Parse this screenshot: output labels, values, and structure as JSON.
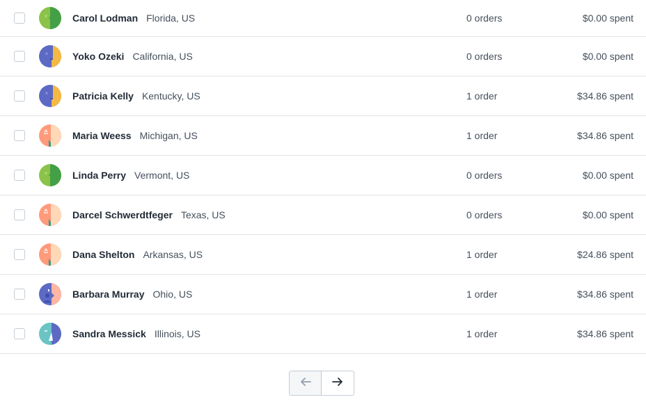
{
  "customers": [
    {
      "name": "Carol Lodman",
      "location": "Florida, US",
      "orders": "0 orders",
      "spent": "$0.00 spent",
      "avatar_icon": "avatar-green-icon"
    },
    {
      "name": "Yoko Ozeki",
      "location": "California, US",
      "orders": "0 orders",
      "spent": "$0.00 spent",
      "avatar_icon": "avatar-purple-yellow-icon"
    },
    {
      "name": "Patricia Kelly",
      "location": "Kentucky, US",
      "orders": "1 order",
      "spent": "$34.86 spent",
      "avatar_icon": "avatar-purple-yellow-icon"
    },
    {
      "name": "Maria Weess",
      "location": "Michigan, US",
      "orders": "1 order",
      "spent": "$34.86 spent",
      "avatar_icon": "avatar-salmon-icon"
    },
    {
      "name": "Linda Perry",
      "location": "Vermont, US",
      "orders": "0 orders",
      "spent": "$0.00 spent",
      "avatar_icon": "avatar-green-icon"
    },
    {
      "name": "Darcel Schwerdtfeger",
      "location": "Texas, US",
      "orders": "0 orders",
      "spent": "$0.00 spent",
      "avatar_icon": "avatar-salmon-icon"
    },
    {
      "name": "Dana Shelton",
      "location": "Arkansas, US",
      "orders": "1 order",
      "spent": "$24.86 spent",
      "avatar_icon": "avatar-salmon-icon"
    },
    {
      "name": "Barbara Murray",
      "location": "Ohio, US",
      "orders": "1 order",
      "spent": "$34.86 spent",
      "avatar_icon": "avatar-purple-pink-icon"
    },
    {
      "name": "Sandra Messick",
      "location": "Illinois, US",
      "orders": "1 order",
      "spent": "$34.86 spent",
      "avatar_icon": "avatar-teal-icon"
    }
  ],
  "pagination": {
    "prev_icon": "arrow-left-icon",
    "next_icon": "arrow-right-icon"
  },
  "colors": {
    "border": "#dfe3e8",
    "text_primary": "#212b36",
    "text_secondary": "#454f5b",
    "arrow_disabled": "#919eab",
    "arrow_enabled": "#212b36"
  }
}
